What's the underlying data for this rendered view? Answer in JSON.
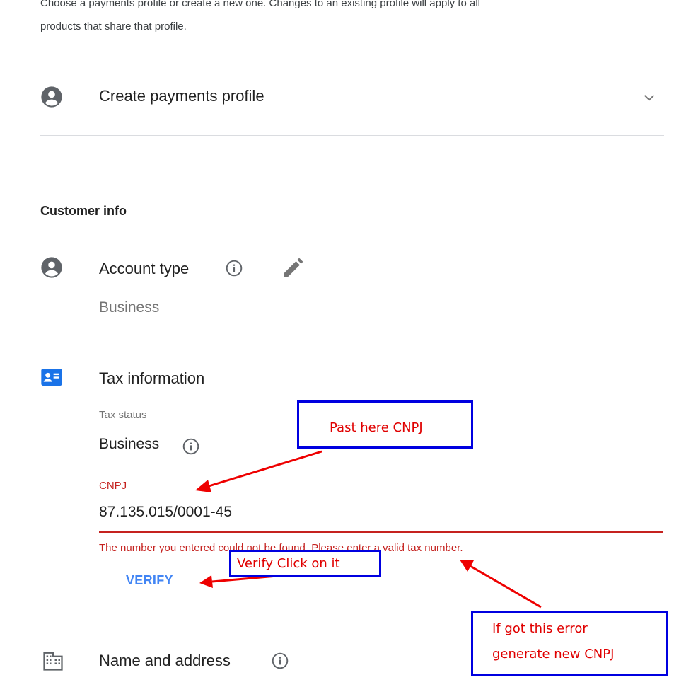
{
  "intro": {
    "line1": "Choose a payments profile or create a new one. Changes to an existing profile will apply to all",
    "line2": "products that share that profile."
  },
  "payments_profile": {
    "label": "Create payments profile",
    "icon": "account-circle-icon",
    "chevron": "chevron-down-icon"
  },
  "customer_info": {
    "heading": "Customer info",
    "account_type": {
      "label": "Account type",
      "value": "Business"
    },
    "tax_information": {
      "label": "Tax information",
      "tax_status_label": "Tax status",
      "tax_status_value": "Business",
      "cnpj_label": "CNPJ",
      "cnpj_value": "87.135.015/0001-45",
      "error_text": "The number you entered could not be found. Please enter a valid tax number.",
      "verify_label": "VERIFY"
    },
    "name_and_address": {
      "label": "Name and address"
    }
  },
  "annotations": {
    "paste_here": "Past here CNPJ",
    "verify_click": "Verify Click on it",
    "error_line1": "If got this error",
    "error_line2": "generate new CNPJ"
  },
  "colors": {
    "error": "#c5221f",
    "link": "#4285f4",
    "tax_icon": "#1a73e8",
    "callout_border": "#0000e0",
    "callout_text": "#e00000"
  }
}
